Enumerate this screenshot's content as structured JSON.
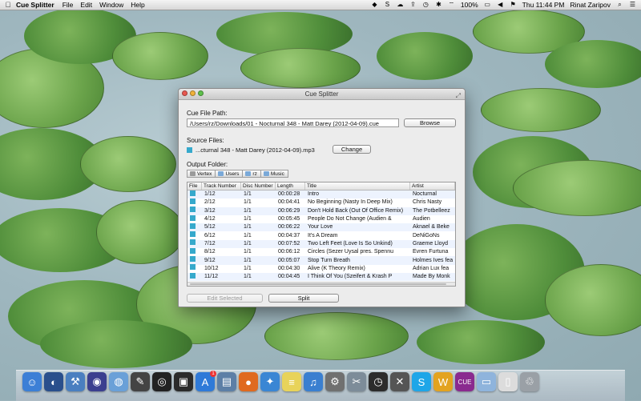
{
  "menubar": {
    "apple": "",
    "app_name": "Cue Splitter",
    "menus": [
      "File",
      "Edit",
      "Window",
      "Help"
    ],
    "battery": "100%",
    "clock": "Thu 11:44 PM",
    "user": "Rinat Zaripov"
  },
  "window": {
    "title": "Cue Splitter",
    "cue_label": "Cue File Path:",
    "cue_path": "/Users/rz/Downloads/01 - Nocturnal 348 - Matt Darey (2012-04-09).cue",
    "browse_label": "Browse",
    "source_label": "Source Files:",
    "source_file": "...cturnal 348 - Matt Darey (2012-04-09).mp3",
    "change_label": "Change",
    "output_label": "Output Folder:",
    "path_crumbs": [
      "Vertex",
      "Users",
      "rz",
      "Music"
    ],
    "columns": [
      "File",
      "Track Number",
      "Disc Number",
      "Length",
      "Title",
      "Artist"
    ],
    "tracks": [
      {
        "track": "1/12",
        "disc": "1/1",
        "length": "00:00:28",
        "title": "Intro",
        "artist": "Nocturnal"
      },
      {
        "track": "2/12",
        "disc": "1/1",
        "length": "00:04:41",
        "title": "No Beginning (Nasty In Deep Mix)",
        "artist": "Chris Nasty"
      },
      {
        "track": "3/12",
        "disc": "1/1",
        "length": "00:06:29",
        "title": "Don't Hold Back (Out Of Office Remix)",
        "artist": "The Potbelleez"
      },
      {
        "track": "4/12",
        "disc": "1/1",
        "length": "00:05:45",
        "title": "People Do Not Change (Audien &",
        "artist": "Audien"
      },
      {
        "track": "5/12",
        "disc": "1/1",
        "length": "00:06:22",
        "title": "Your Love",
        "artist": "Aknael & Beke"
      },
      {
        "track": "6/12",
        "disc": "1/1",
        "length": "00:04:37",
        "title": "It's A Dream",
        "artist": "DeNiGoNs"
      },
      {
        "track": "7/12",
        "disc": "1/1",
        "length": "00:07:52",
        "title": "Two Left Feet (Love Is So Unkind)",
        "artist": "Graeme Lloyd"
      },
      {
        "track": "8/12",
        "disc": "1/1",
        "length": "00:06:12",
        "title": "Circles (Sezer Uysal pres. Spennu",
        "artist": "Evren Furtuna"
      },
      {
        "track": "9/12",
        "disc": "1/1",
        "length": "00:05:07",
        "title": "Stop Turn Breath",
        "artist": "Holmes Ives fea"
      },
      {
        "track": "10/12",
        "disc": "1/1",
        "length": "00:04:30",
        "title": "Alive (K Theory Remix)",
        "artist": "Adrian Lux fea"
      },
      {
        "track": "11/12",
        "disc": "1/1",
        "length": "00:04:45",
        "title": "I Think Of You (Szeifert & Krash P",
        "artist": "Made By Monk"
      }
    ],
    "edit_selected_label": "Edit Selected",
    "split_label": "Split"
  },
  "dock": {
    "items": [
      {
        "name": "finder-icon",
        "glyph": "☺",
        "color": "#3c7fd6"
      },
      {
        "name": "dashboard-icon",
        "glyph": "◐",
        "color": "#2a4f8c"
      },
      {
        "name": "xcode-icon",
        "glyph": "⚒",
        "color": "#4a7fc0"
      },
      {
        "name": "eclipse-icon",
        "glyph": "◉",
        "color": "#3b3f8f"
      },
      {
        "name": "network-icon",
        "glyph": "◍",
        "color": "#6aa0d8"
      },
      {
        "name": "tools-icon",
        "glyph": "✎",
        "color": "#444444"
      },
      {
        "name": "camera-icon",
        "glyph": "◎",
        "color": "#222222"
      },
      {
        "name": "photo-booth-icon",
        "glyph": "▣",
        "color": "#2b2b2b"
      },
      {
        "name": "app-store-icon",
        "glyph": "A",
        "color": "#2f7ad8",
        "badge": "1"
      },
      {
        "name": "preview-icon",
        "glyph": "▤",
        "color": "#5d7fa6"
      },
      {
        "name": "firefox-icon",
        "glyph": "●",
        "color": "#e06a1f"
      },
      {
        "name": "safari-icon",
        "glyph": "✦",
        "color": "#3a86d4"
      },
      {
        "name": "notes-icon",
        "glyph": "≡",
        "color": "#e8d35a"
      },
      {
        "name": "itunes-icon",
        "glyph": "♫",
        "color": "#3a7fd0"
      },
      {
        "name": "system-prefs-icon",
        "glyph": "⚙",
        "color": "#707070"
      },
      {
        "name": "utility-icon",
        "glyph": "✂",
        "color": "#7d8c99"
      },
      {
        "name": "clock-icon",
        "glyph": "◷",
        "color": "#2c2c2c"
      },
      {
        "name": "grapher-icon",
        "glyph": "✕",
        "color": "#555555"
      },
      {
        "name": "skype-icon",
        "glyph": "S",
        "color": "#1ea6e8"
      },
      {
        "name": "wizard-icon",
        "glyph": "W",
        "color": "#e3a320"
      },
      {
        "name": "cue-splitter-icon",
        "glyph": "CUE",
        "color": "#8a2a8f"
      },
      {
        "name": "folder-icon",
        "glyph": "▭",
        "color": "#8fb4dc"
      },
      {
        "name": "document-icon",
        "glyph": "▯",
        "color": "#dcdcdc"
      },
      {
        "name": "trash-icon",
        "glyph": "♲",
        "color": "#9aa0a6"
      }
    ]
  }
}
